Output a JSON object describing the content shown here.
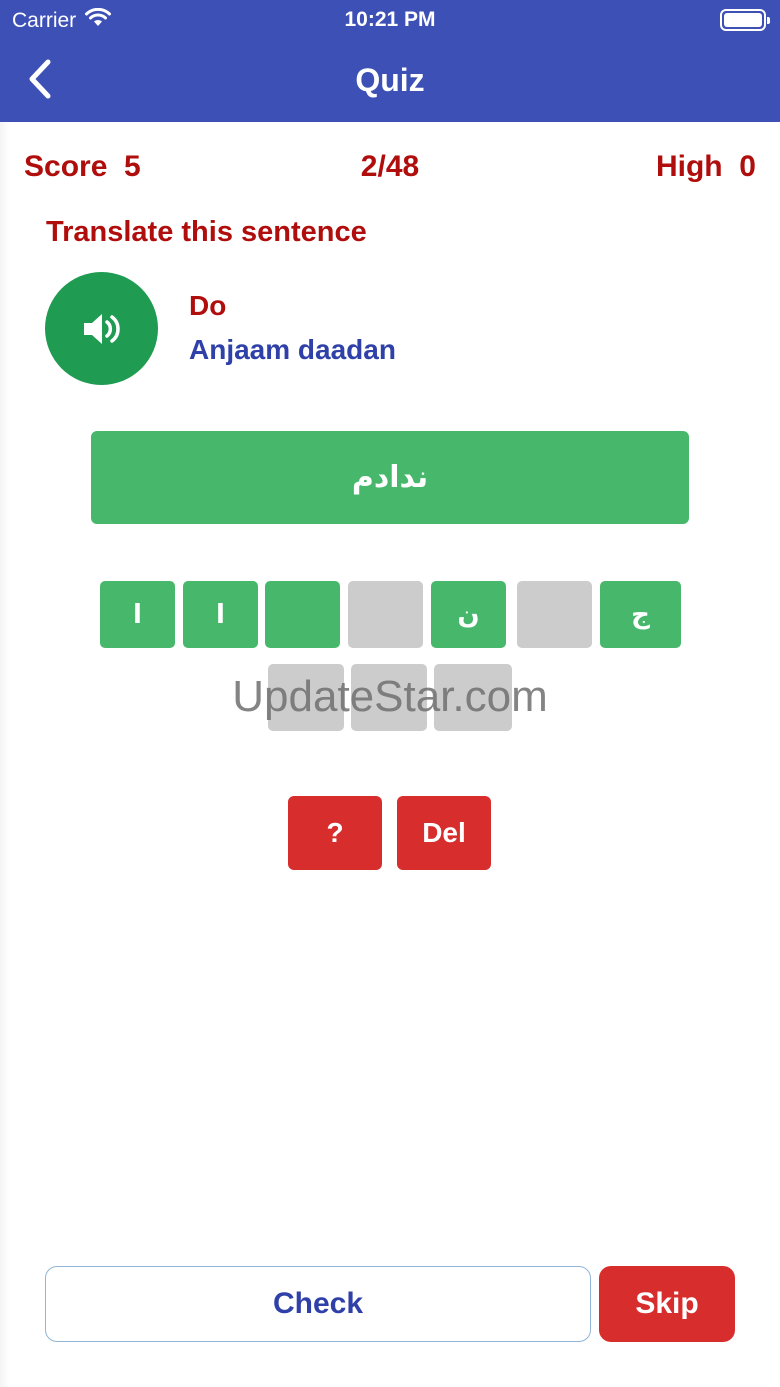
{
  "status": {
    "carrier": "Carrier",
    "time": "10:21 PM"
  },
  "nav": {
    "title": "Quiz"
  },
  "scoreline": {
    "score_label": "Score  5",
    "progress": "2/48",
    "high_label": "High  0"
  },
  "prompt": {
    "instruction": "Translate this sentence",
    "word": "Do",
    "transliteration": "Anjaam daadan"
  },
  "answer": {
    "text": "ندادم"
  },
  "tiles": {
    "row1": [
      {
        "letter": "ا",
        "state": "green"
      },
      {
        "letter": "ا",
        "state": "green"
      },
      {
        "letter": "",
        "state": "green"
      },
      {
        "letter": "",
        "state": "gray"
      },
      {
        "letter": "ن",
        "state": "green"
      },
      {
        "letter": "",
        "state": "gray"
      },
      {
        "letter": "ج",
        "state": "green"
      }
    ],
    "row2": [
      {
        "letter": "",
        "state": "gray"
      },
      {
        "letter": "",
        "state": "gray"
      },
      {
        "letter": "",
        "state": "gray"
      }
    ]
  },
  "watermark": "UpdateStar.com",
  "actions": {
    "hint_label": "?",
    "del_label": "Del",
    "check_label": "Check",
    "skip_label": "Skip"
  },
  "colors": {
    "brand_blue": "#3d50b5",
    "score_red": "#b00d0d",
    "tile_green": "#47b86b",
    "tile_gray": "#cccccc",
    "button_red": "#d72d2d",
    "speaker_green": "#1f9b52"
  },
  "icons": {
    "back": "chevron-left-icon",
    "speaker": "speaker-icon",
    "wifi": "wifi-icon",
    "battery": "battery-icon"
  }
}
